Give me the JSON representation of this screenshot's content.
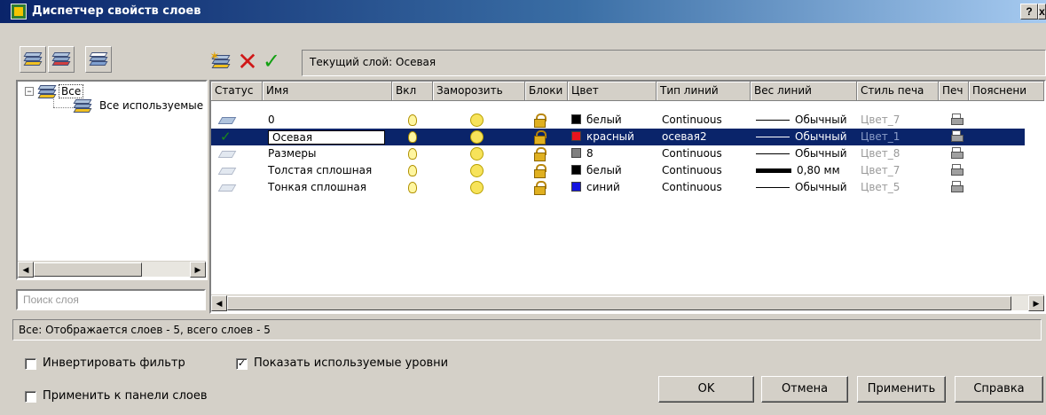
{
  "window": {
    "title": "Диспетчер свойств слоев",
    "help_label": "?",
    "close_label": "x"
  },
  "toolbar": {
    "current_layer_label": "Текущий слой: Осевая"
  },
  "tree": {
    "root_label": "Все",
    "child_label": "Все используемые"
  },
  "search": {
    "placeholder": "Поиск слоя"
  },
  "grid": {
    "columns": [
      "Статус",
      "Имя",
      "Вкл",
      "Заморозить",
      "Блоки",
      "Цвет",
      "Тип линий",
      "Вес линий",
      "Стиль печа",
      "Печ",
      "Пояснени"
    ],
    "rows": [
      {
        "name": "0",
        "color_name": "белый",
        "color_hex": "#000000",
        "linetype": "Continuous",
        "lineweight": "Обычный",
        "plotstyle": "Цвет_7",
        "current": false,
        "selected": false,
        "thick": false
      },
      {
        "name": "Осевая",
        "color_name": "красный",
        "color_hex": "#e8141e",
        "linetype": "осевая2",
        "lineweight": "Обычный",
        "plotstyle": "Цвет_1",
        "current": true,
        "selected": true,
        "thick": false
      },
      {
        "name": "Размеры",
        "color_name": "8",
        "color_hex": "#808080",
        "linetype": "Continuous",
        "lineweight": "Обычный",
        "plotstyle": "Цвет_8",
        "current": false,
        "selected": false,
        "thick": false
      },
      {
        "name": "Толстая сплошная",
        "color_name": "белый",
        "color_hex": "#000000",
        "linetype": "Continuous",
        "lineweight": "0,80 мм",
        "plotstyle": "Цвет_7",
        "current": false,
        "selected": false,
        "thick": true
      },
      {
        "name": "Тонкая сплошная",
        "color_name": "синий",
        "color_hex": "#1414e0",
        "linetype": "Continuous",
        "lineweight": "Обычный",
        "plotstyle": "Цвет_5",
        "current": false,
        "selected": false,
        "thick": false
      }
    ]
  },
  "status": {
    "text": "Все: Отображается слоев - 5, всего слоев - 5"
  },
  "options": {
    "invert_filter": {
      "label": "Инвертировать фильтр",
      "checked": false
    },
    "show_used": {
      "label": "Показать используемые уровни",
      "checked": true
    },
    "apply_to_panel": {
      "label": "Применить к панели слоев",
      "checked": false
    }
  },
  "buttons": {
    "ok": "OK",
    "cancel": "Отмена",
    "apply": "Применить",
    "help": "Справка"
  },
  "colors": {
    "selection": "#0a246a",
    "dialog_bg": "#d4d0c8",
    "titlebar_start": "#0a246a"
  }
}
